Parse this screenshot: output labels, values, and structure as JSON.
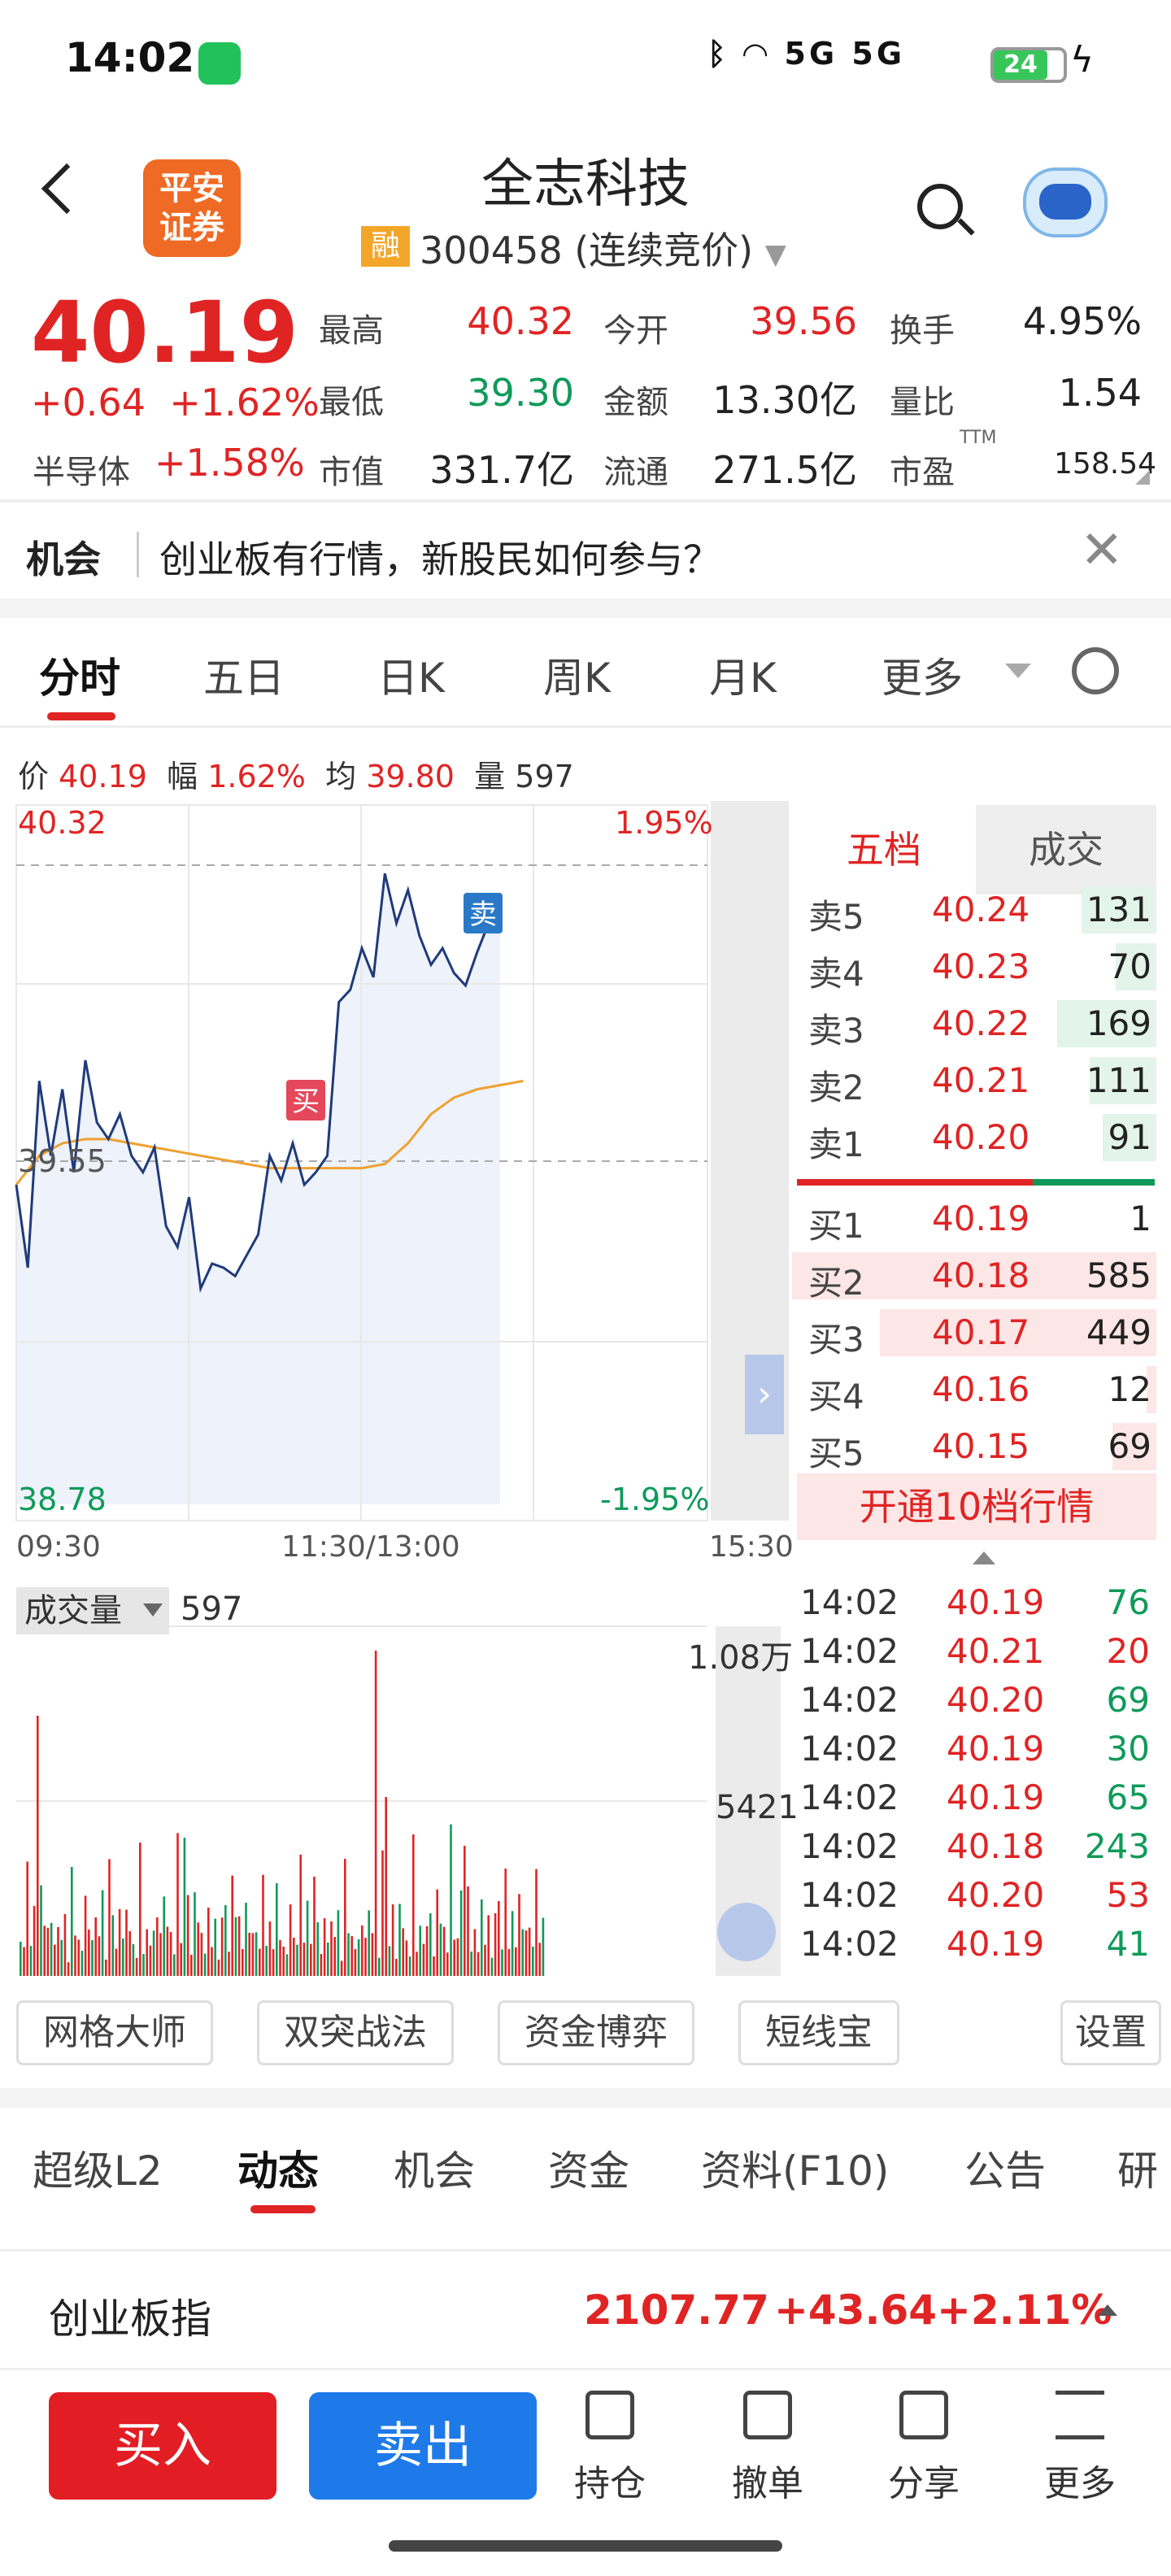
{
  "status_bar": {
    "time": "14:02",
    "network": "5G 5G",
    "battery": "24",
    "icons": [
      "wechat-icon",
      "bluetooth-icon",
      "wifi-icon",
      "signal-icon",
      "battery-icon",
      "charging-icon"
    ]
  },
  "header": {
    "brand_line1": "平安",
    "brand_line2": "证券",
    "stock_name": "全志科技",
    "margin_badge": "融",
    "stock_code": "300458 (连续竞价)"
  },
  "quote": {
    "price": "40.19",
    "change": "+0.64",
    "change_pct": "+1.62%",
    "sector_name": "半导体",
    "sector_change": "+1.58%",
    "high_label": "最高",
    "high": "40.32",
    "open_label": "今开",
    "open": "39.56",
    "turnover_label": "换手",
    "turnover": "4.95%",
    "low_label": "最低",
    "low": "39.30",
    "amount_label": "金额",
    "amount": "13.30亿",
    "volume_ratio_label": "量比",
    "volume_ratio": "1.54",
    "mktcap_label": "市值",
    "mktcap": "331.7亿",
    "float_label": "流通",
    "float": "271.5亿",
    "pe_label": "市盈",
    "pe_sup": "TTM",
    "pe": "158.54"
  },
  "banner": {
    "tag": "机会",
    "text": "创业板有行情，新股民如何参与？",
    "close": "✕"
  },
  "chart_tabs": [
    "分时",
    "五日",
    "日K",
    "周K",
    "月K",
    "更多"
  ],
  "info_line": {
    "price_label": "价",
    "price": "40.19",
    "pct_label": "幅",
    "pct": "1.62%",
    "avg_label": "均",
    "avg": "39.80",
    "vol_label": "量",
    "vol": "597"
  },
  "chart_axis": {
    "top_price": "40.32",
    "top_pct": "1.95%",
    "mid_price": "39.55",
    "bottom_price": "38.78",
    "bottom_pct": "-1.95%",
    "time_start": "09:30",
    "time_mid": "11:30/13:00",
    "time_end": "15:30",
    "buy_marker": "买",
    "sell_marker": "卖"
  },
  "chart_data": {
    "type": "line",
    "ylim": [
      38.78,
      40.32
    ],
    "series": [
      {
        "values": [
          39.55,
          39.35,
          39.8,
          39.62,
          39.78,
          39.58,
          39.85,
          39.7,
          39.66,
          39.72,
          39.62,
          39.58,
          39.64,
          39.45,
          39.4,
          39.52,
          39.3,
          39.36,
          39.35,
          39.33,
          39.38,
          39.43,
          39.62,
          39.56,
          39.65,
          39.55,
          39.58,
          39.62,
          39.99,
          40.02,
          40.12,
          40.05,
          40.3,
          40.18,
          40.26,
          40.15,
          40.08,
          40.12,
          40.06,
          40.03,
          40.11,
          40.18,
          40.25
        ]
      },
      {
        "values": [
          39.55,
          39.62,
          39.65,
          39.66,
          39.66,
          39.65,
          39.64,
          39.63,
          39.62,
          39.61,
          39.6,
          39.59,
          39.59,
          39.59,
          39.59,
          39.59,
          39.6,
          39.65,
          39.72,
          39.76,
          39.78,
          39.79,
          39.8
        ]
      }
    ]
  },
  "order_book": {
    "tab_left": "五档",
    "tab_right": "成交",
    "asks": [
      {
        "label": "卖5",
        "price": "40.24",
        "volume": "131"
      },
      {
        "label": "卖4",
        "price": "40.23",
        "volume": "70"
      },
      {
        "label": "卖3",
        "price": "40.22",
        "volume": "169"
      },
      {
        "label": "卖2",
        "price": "40.21",
        "volume": "111"
      },
      {
        "label": "卖1",
        "price": "40.20",
        "volume": "91"
      }
    ],
    "bids": [
      {
        "label": "买1",
        "price": "40.19",
        "volume": "1"
      },
      {
        "label": "买2",
        "price": "40.18",
        "volume": "585"
      },
      {
        "label": "买3",
        "price": "40.17",
        "volume": "449"
      },
      {
        "label": "买4",
        "price": "40.16",
        "volume": "12"
      },
      {
        "label": "买5",
        "price": "40.15",
        "volume": "69"
      }
    ],
    "unlock": "开通10档行情"
  },
  "ticks": [
    {
      "time": "14:02",
      "price": "40.19",
      "volume": "76",
      "dir": "up"
    },
    {
      "time": "14:02",
      "price": "40.21",
      "volume": "20",
      "dir": "down"
    },
    {
      "time": "14:02",
      "price": "40.20",
      "volume": "69",
      "dir": "up"
    },
    {
      "time": "14:02",
      "price": "40.19",
      "volume": "30",
      "dir": "up"
    },
    {
      "time": "14:02",
      "price": "40.19",
      "volume": "65",
      "dir": "up"
    },
    {
      "time": "14:02",
      "price": "40.18",
      "volume": "243",
      "dir": "up"
    },
    {
      "time": "14:02",
      "price": "40.20",
      "volume": "53",
      "dir": "down"
    },
    {
      "time": "14:02",
      "price": "40.19",
      "volume": "41",
      "dir": "up"
    }
  ],
  "volume": {
    "label": "成交量",
    "value": "597",
    "max_label": "1.08万",
    "mid_label": "5421"
  },
  "tools": [
    "网格大师",
    "双突战法",
    "资金博弈",
    "短线宝",
    "设置"
  ],
  "bottom_tabs": [
    "超级L2",
    "动态",
    "机会",
    "资金",
    "资料(F10)",
    "公告",
    "研"
  ],
  "index": {
    "name": "创业板指",
    "price": "2107.77",
    "change": "+43.64",
    "pct": "+2.11%"
  },
  "actions": {
    "buy": "买入",
    "sell": "卖出",
    "holdings": "持仓",
    "cancel": "撤单",
    "share": "分享",
    "more": "更多"
  },
  "colors": {
    "up_red": "#e02424",
    "down_green": "#109a5a",
    "price_line": "#1f3b7a",
    "avg_line": "#f0a030",
    "buy_button": "#e21d24",
    "sell_button": "#1e7ae8"
  }
}
